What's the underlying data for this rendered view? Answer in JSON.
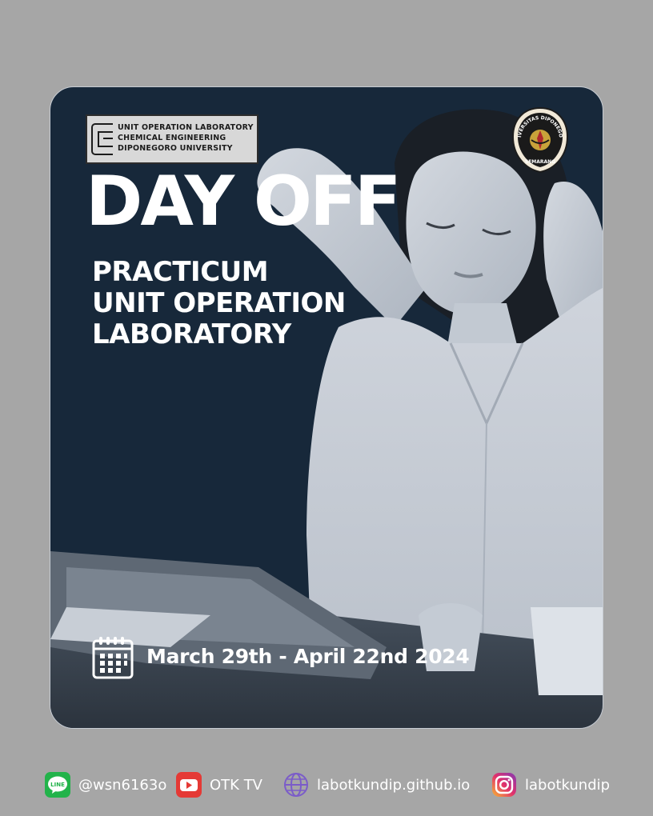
{
  "lab_logo": {
    "line1": "UNIT OPERATION LABORATORY",
    "line2": "CHEMICAL ENGINEERING",
    "line3": "DIPONEGORO UNIVERSITY"
  },
  "seal": {
    "top_text": "UNIVERSITAS DIPONEGORO",
    "bottom_text": "SEMARANG"
  },
  "headline": "DAY OFF",
  "subtitle": {
    "line1": "PRACTICUM",
    "line2": "UNIT OPERATION",
    "line3": "LABORATORY"
  },
  "date_icon": "calendar-icon",
  "dates": "March 29th - April 22nd 2024",
  "footer": {
    "line": {
      "icon": "line-app-icon",
      "icon_text": "LINE",
      "label": "@wsn6163o",
      "color": "#22b34a"
    },
    "youtube": {
      "icon": "youtube-icon",
      "label": "OTK TV",
      "color": "#e53935"
    },
    "website": {
      "icon": "globe-icon",
      "label": "labotkundip.github.io",
      "color": "#7b5cc9"
    },
    "instagram": {
      "icon": "instagram-icon",
      "label": "labotkundip",
      "color": "#d6336c"
    }
  },
  "colors": {
    "background": "#a6a6a6",
    "card": "#17283a",
    "text": "#ffffff"
  }
}
